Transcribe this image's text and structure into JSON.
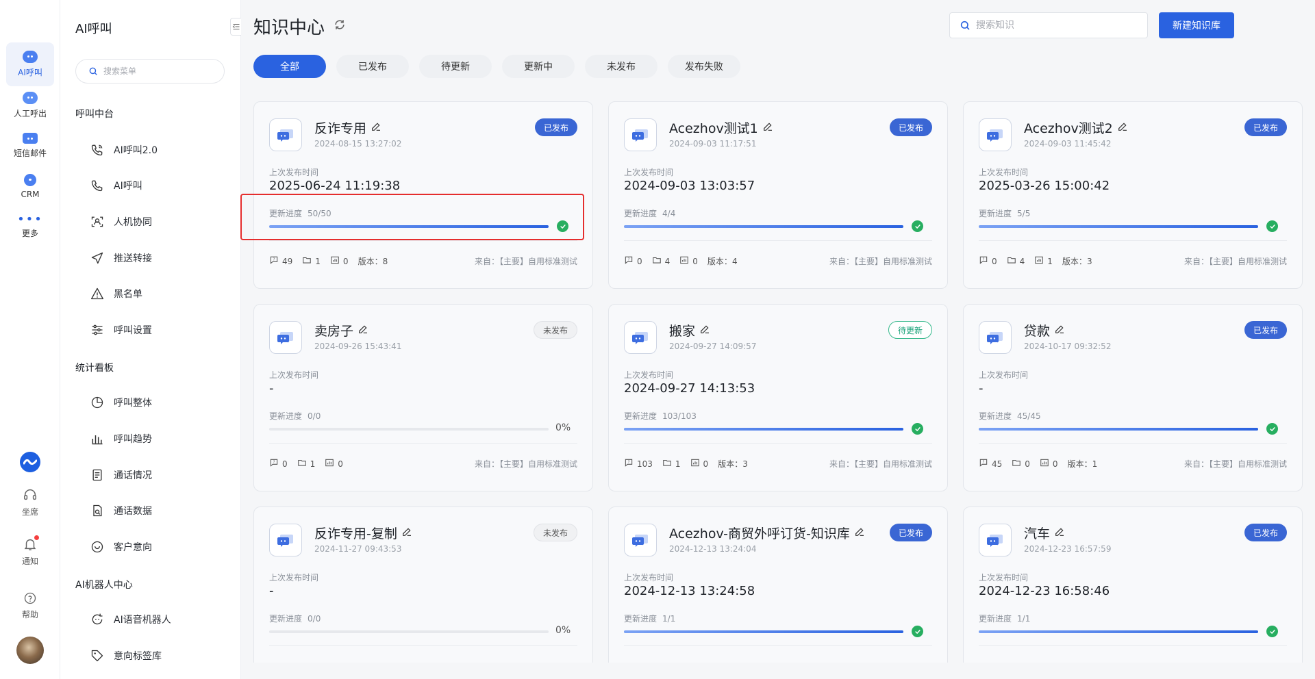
{
  "rail": {
    "items": [
      {
        "label": "AI呼叫"
      },
      {
        "label": "人工呼出"
      },
      {
        "label": "短信邮件"
      },
      {
        "label": "CRM"
      },
      {
        "label": "更多"
      }
    ],
    "bottom": [
      {
        "label": "坐席"
      },
      {
        "label": "通知"
      },
      {
        "label": "帮助"
      }
    ]
  },
  "menu": {
    "title": "AI呼叫",
    "search_placeholder": "搜索菜单",
    "groups": [
      {
        "title": "呼叫中台",
        "items": [
          "AI呼叫2.0",
          "AI呼叫",
          "人机协同",
          "推送转接",
          "黑名单",
          "呼叫设置"
        ]
      },
      {
        "title": "统计看板",
        "items": [
          "呼叫整体",
          "呼叫趋势",
          "通话情况",
          "通话数据",
          "客户意向"
        ]
      },
      {
        "title": "AI机器人中心",
        "items": [
          "AI语音机器人",
          "意向标签库"
        ]
      }
    ]
  },
  "header": {
    "title": "知识中心",
    "search_placeholder": "搜索知识",
    "new_button": "新建知识库"
  },
  "filters": [
    "全部",
    "已发布",
    "待更新",
    "更新中",
    "未发布",
    "发布失败"
  ],
  "labels": {
    "last_publish": "上次发布时间",
    "progress": "更新进度",
    "version_prefix": "版本：",
    "source_prefix": "来自：",
    "source": "【主要】自用标准测试"
  },
  "cards": [
    {
      "name": "反诈专用",
      "created": "2024-08-15 13:27:02",
      "status": "已发布",
      "status_type": "pub",
      "last_publish": "2025-06-24 11:19:38",
      "progress_text": "50/50",
      "progress": 1,
      "pct": "",
      "qa": "49",
      "folders": "1",
      "charts": "0",
      "version": "8"
    },
    {
      "name": "Acezhov测试1",
      "created": "2024-09-03 11:17:51",
      "status": "已发布",
      "status_type": "pub",
      "last_publish": "2024-09-03 13:03:57",
      "progress_text": "4/4",
      "progress": 1,
      "pct": "",
      "qa": "0",
      "folders": "4",
      "charts": "0",
      "version": "4"
    },
    {
      "name": "Acezhov测试2",
      "created": "2024-09-03 11:45:42",
      "status": "已发布",
      "status_type": "pub",
      "last_publish": "2025-03-26 15:00:42",
      "progress_text": "5/5",
      "progress": 1,
      "pct": "",
      "qa": "0",
      "folders": "4",
      "charts": "1",
      "version": "3"
    },
    {
      "name": "卖房子",
      "created": "2024-09-26 15:43:41",
      "status": "未发布",
      "status_type": "unpub",
      "last_publish": "-",
      "progress_text": "0/0",
      "progress": 0,
      "pct": "0%",
      "qa": "0",
      "folders": "1",
      "charts": "0",
      "version": ""
    },
    {
      "name": "搬家",
      "created": "2024-09-27 14:09:57",
      "status": "待更新",
      "status_type": "pend",
      "last_publish": "2024-09-27 14:13:53",
      "progress_text": "103/103",
      "progress": 1,
      "pct": "",
      "qa": "103",
      "folders": "1",
      "charts": "0",
      "version": "3"
    },
    {
      "name": "贷款",
      "created": "2024-10-17 09:32:52",
      "status": "已发布",
      "status_type": "pub",
      "last_publish": "-",
      "progress_text": "45/45",
      "progress": 1,
      "pct": "",
      "qa": "45",
      "folders": "0",
      "charts": "0",
      "version": "1"
    },
    {
      "name": "反诈专用-复制",
      "created": "2024-11-27 09:43:53",
      "status": "未发布",
      "status_type": "unpub",
      "last_publish": "-",
      "progress_text": "0/0",
      "progress": 0,
      "pct": "0%",
      "qa": "",
      "folders": "",
      "charts": "",
      "version": ""
    },
    {
      "name": "Acezhov-商贸外呼订货-知识库",
      "created": "2024-12-13 13:24:04",
      "status": "已发布",
      "status_type": "pub",
      "last_publish": "2024-12-13 13:24:58",
      "progress_text": "1/1",
      "progress": 1,
      "pct": "",
      "qa": "",
      "folders": "",
      "charts": "",
      "version": ""
    },
    {
      "name": "汽车",
      "created": "2024-12-23 16:57:59",
      "status": "已发布",
      "status_type": "pub",
      "last_publish": "2024-12-23 16:58:46",
      "progress_text": "1/1",
      "progress": 1,
      "pct": "",
      "qa": "",
      "folders": "",
      "charts": "",
      "version": ""
    }
  ]
}
